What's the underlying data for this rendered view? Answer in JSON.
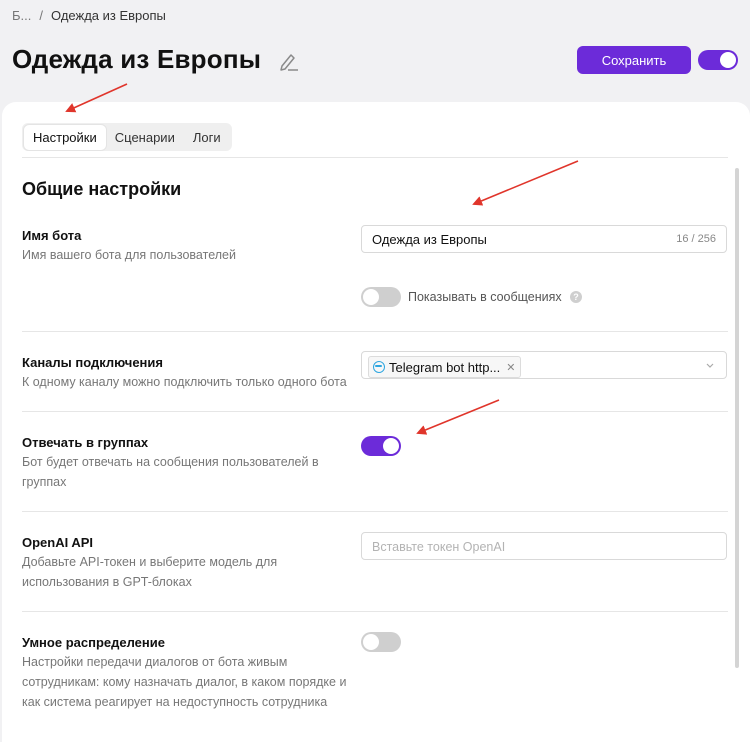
{
  "breadcrumb": {
    "root": "Б...",
    "separator": "/",
    "current": "Одежда из Европы"
  },
  "header": {
    "title": "Одежда из Европы",
    "save_label": "Сохранить",
    "bot_enabled": true
  },
  "tabs": [
    {
      "label": "Настройки",
      "active": true
    },
    {
      "label": "Сценарии",
      "active": false
    },
    {
      "label": "Логи",
      "active": false
    }
  ],
  "section": {
    "title": "Общие настройки"
  },
  "bot_name": {
    "title": "Имя бота",
    "description": "Имя вашего бота для пользователей",
    "value": "Одежда из Европы",
    "counter": "16 / 256",
    "show_in_messages_label": "Показывать в сообщениях",
    "show_in_messages": false
  },
  "channels": {
    "title": "Каналы подключения",
    "description": "К одному каналу можно подключить только одного бота",
    "selected_chip": "Telegram bot http..."
  },
  "groups": {
    "title": "Отвечать в группах",
    "description": "Бот будет отвечать на сообщения пользователей в группах",
    "enabled": true
  },
  "openai": {
    "title": "OpenAI API",
    "description": "Добавьте API-токен и выберите модель для использования в GPT-блоках",
    "placeholder": "Вставьте токен OpenAI"
  },
  "smart_distribution": {
    "title": "Умное распределение",
    "description": "Настройки передачи диалогов от бота живым сотрудникам: кому назначать диалог, в каком порядке и как система реагирует на недоступность сотрудника",
    "enabled": false
  },
  "colors": {
    "accent": "#6c2bd9",
    "annotation_arrow": "#e0352b"
  }
}
